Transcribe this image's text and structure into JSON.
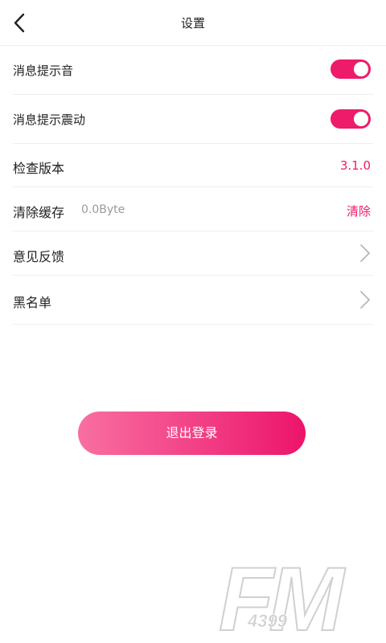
{
  "header": {
    "title": "设置",
    "back_icon": "chevron-left-icon"
  },
  "settings": {
    "message_sound": {
      "label": "消息提示音",
      "enabled": true
    },
    "message_vibrate": {
      "label": "消息提示震动",
      "enabled": true
    },
    "check_version": {
      "label": "检查版本",
      "value": "3.1.0"
    },
    "clear_cache": {
      "label": "清除缓存",
      "size": "0.0Byte",
      "action": "清除"
    },
    "feedback": {
      "label": "意见反馈",
      "icon": "chevron-right-icon"
    },
    "blacklist": {
      "label": "黑名单",
      "icon": "chevron-right-icon"
    }
  },
  "logout": {
    "label": "退出登录"
  },
  "watermark": {
    "brand": "FM",
    "number": "4399"
  },
  "colors": {
    "accent": "#ee1b6a",
    "gradient_start": "#f86fa0",
    "gradient_end": "#ec146a"
  }
}
